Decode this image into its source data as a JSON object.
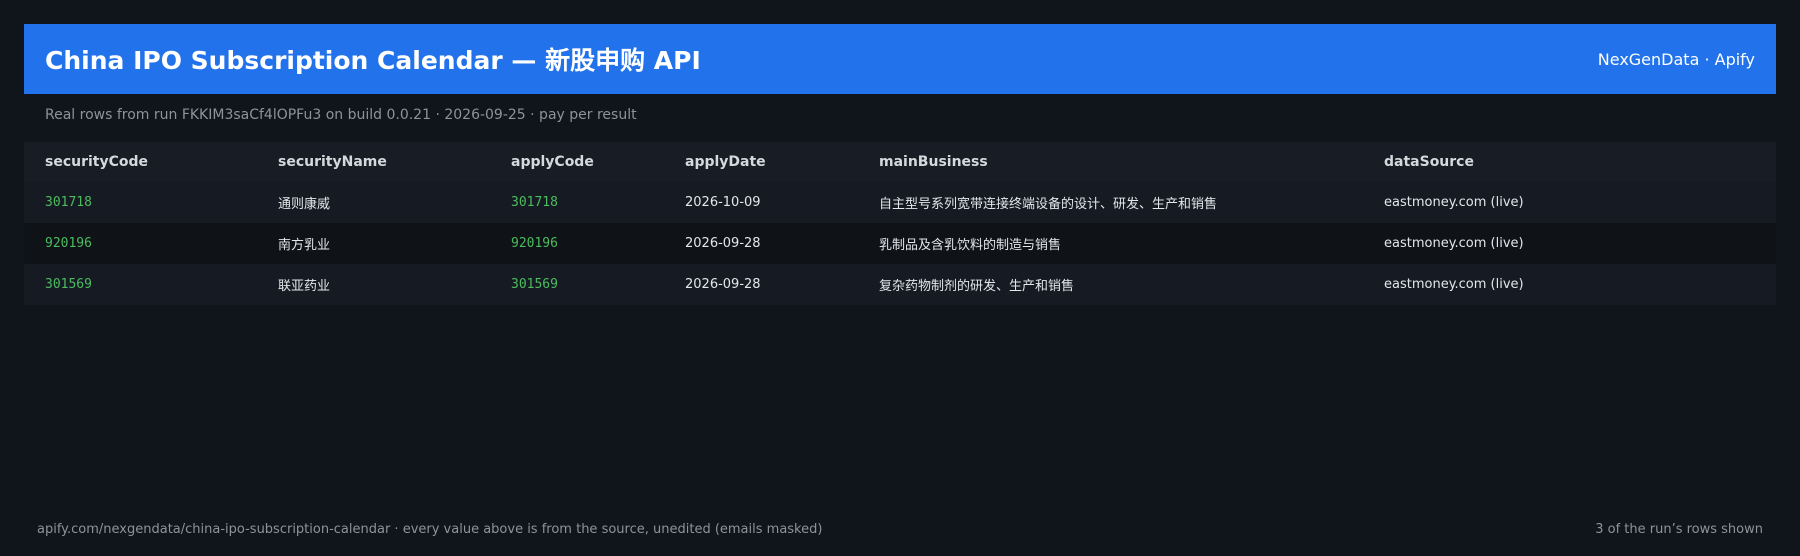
{
  "header": {
    "title": "China IPO Subscription Calendar — 新股申购 API",
    "brand": "NexGenData · Apify"
  },
  "subtitle": "Real rows from run FKKIM3saCf4lOPFu3 on build 0.0.21 · 2026-09-25 · pay per result",
  "table": {
    "columns": [
      "securityCode",
      "securityName",
      "applyCode",
      "applyDate",
      "mainBusiness",
      "dataSource"
    ],
    "rows": [
      [
        "301718",
        "通则康威",
        "301718",
        "2026-10-09",
        "自主型号系列宽带连接终端设备的设计、研发、生产和销售",
        "eastmoney.com (live)"
      ],
      [
        "920196",
        "南方乳业",
        "920196",
        "2026-09-28",
        "乳制品及含乳饮料的制造与销售",
        "eastmoney.com (live)"
      ],
      [
        "301569",
        "联亚药业",
        "301569",
        "2026-09-28",
        "复杂药物制剂的研发、生产和销售",
        "eastmoney.com (live)"
      ]
    ]
  },
  "footer": {
    "left": "apify.com/nexgendata/china-ipo-subscription-calendar  ·  every value above is from the source, unedited (emails masked)",
    "right": "3 of the run’s rows shown"
  },
  "colors": {
    "background": "#10141b",
    "header": "#2172eb",
    "code": "#4dbb5f"
  }
}
